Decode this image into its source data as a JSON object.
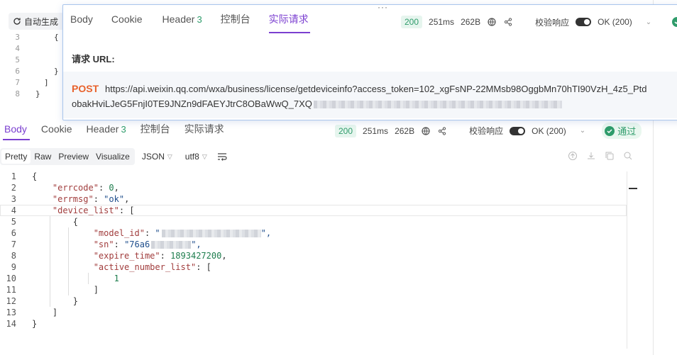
{
  "background": {
    "autogen_label": "自动生成",
    "lines": [
      {
        "num": "3",
        "text": "{"
      },
      {
        "num": "4",
        "text": ""
      },
      {
        "num": "5",
        "text": ""
      },
      {
        "num": "6",
        "text": "}"
      },
      {
        "num": "7",
        "text": "]"
      },
      {
        "num": "8",
        "text": "}"
      }
    ]
  },
  "popup": {
    "tabs": [
      {
        "label": "Body",
        "count": ""
      },
      {
        "label": "Cookie",
        "count": ""
      },
      {
        "label": "Header",
        "count": "3"
      },
      {
        "label": "控制台",
        "count": ""
      },
      {
        "label": "实际请求",
        "count": ""
      }
    ],
    "status_code": "200",
    "time": "251ms",
    "size": "262B",
    "validate_label": "校验响应",
    "validate_value": "OK (200)",
    "request_url_label": "请求 URL:",
    "method": "POST",
    "url_line1": "https://api.weixin.qq.com/wxa/business/license/getdeviceinfo?access_token=102_xgFsNP-22MMsb98OggbMn70hTI90VzH_4z5_Ptd",
    "url_line2": "obakHviLJeG5FnjI0TE9JNZn9dFAEYJtrC8OBaWwQ_7XQ"
  },
  "response": {
    "tabs": [
      {
        "label": "Body",
        "count": ""
      },
      {
        "label": "Cookie",
        "count": ""
      },
      {
        "label": "Header",
        "count": "3"
      },
      {
        "label": "控制台",
        "count": ""
      },
      {
        "label": "实际请求",
        "count": ""
      }
    ],
    "status_code": "200",
    "time": "251ms",
    "size": "262B",
    "validate_label": "校验响应",
    "validate_value": "OK (200)",
    "pass_label": "通过",
    "format_modes": [
      "Pretty",
      "Raw",
      "Preview",
      "Visualize"
    ],
    "format_type": "JSON",
    "encoding": "utf8",
    "code_lines": [
      {
        "num": "1",
        "text": "{"
      },
      {
        "num": "2",
        "key": "\"errcode\"",
        "value": "0",
        "vtype": "n",
        "trail": ","
      },
      {
        "num": "3",
        "key": "\"errmsg\"",
        "value": "\"ok\"",
        "vtype": "s",
        "trail": ","
      },
      {
        "num": "4",
        "key": "\"device_list\"",
        "value": "[",
        "vtype": "p",
        "trail": ""
      },
      {
        "num": "5",
        "text": "{"
      },
      {
        "num": "6",
        "key": "\"model_id\"",
        "value": "\"",
        "vtype": "s",
        "trail": "\","
      },
      {
        "num": "7",
        "key": "\"sn\"",
        "value": "\"76a6",
        "vtype": "s",
        "trail": "\","
      },
      {
        "num": "8",
        "key": "\"expire_time\"",
        "value": "1893427200",
        "vtype": "n",
        "trail": ","
      },
      {
        "num": "9",
        "key": "\"active_number_list\"",
        "value": "[",
        "vtype": "p",
        "trail": ""
      },
      {
        "num": "10",
        "text": "1",
        "ttype": "n"
      },
      {
        "num": "11",
        "text": "]"
      },
      {
        "num": "12",
        "text": "}"
      },
      {
        "num": "13",
        "text": "]"
      },
      {
        "num": "14",
        "text": "}"
      }
    ]
  },
  "colors": {
    "accent": "#7b3fd0",
    "success": "#2f9c6b",
    "method": "#e8622c"
  }
}
